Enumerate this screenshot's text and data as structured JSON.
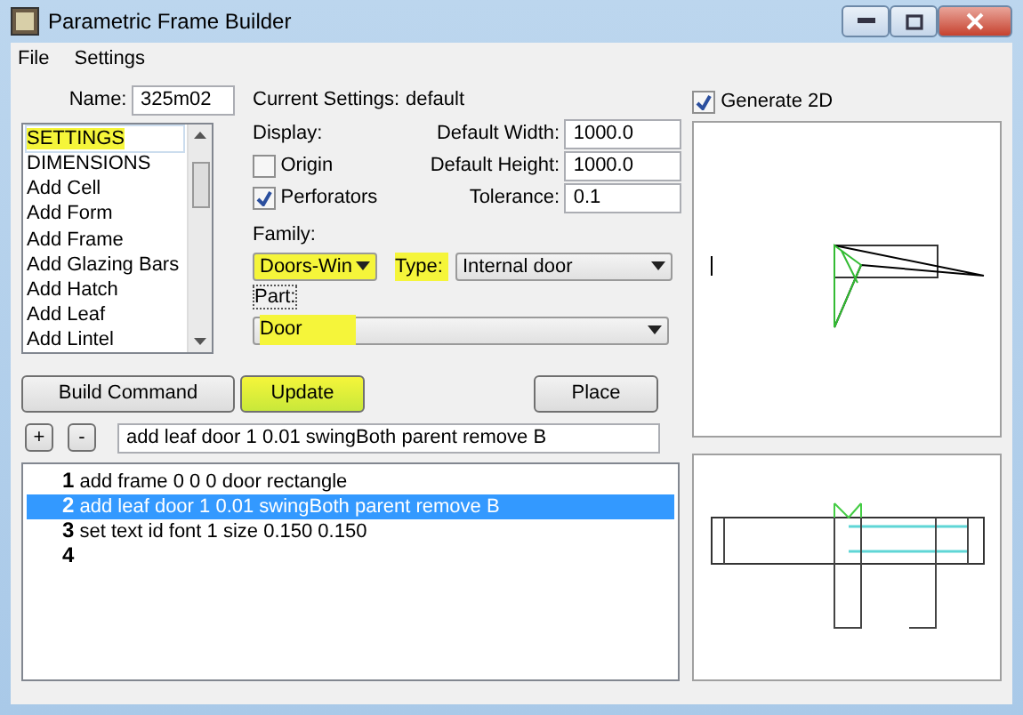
{
  "window": {
    "title": "Parametric Frame Builder"
  },
  "menu": [
    "File",
    "Settings"
  ],
  "name": {
    "label": "Name:",
    "value": "325m02"
  },
  "current_settings": {
    "label": "Current Settings:",
    "value": "default"
  },
  "commands": [
    {
      "label": "SETTINGS",
      "selected": true,
      "highlighted": true
    },
    {
      "label": "DIMENSIONS",
      "selected": false,
      "highlighted": false
    },
    {
      "label": "Add Cell",
      "selected": false,
      "highlighted": false
    },
    {
      "label": "Add Form",
      "selected": false,
      "highlighted": false
    },
    {
      "label": "Add Frame",
      "selected": false,
      "highlighted": false
    },
    {
      "label": "Add Glazing Bars",
      "selected": false,
      "highlighted": false
    },
    {
      "label": "Add Hatch",
      "selected": false,
      "highlighted": false
    },
    {
      "label": "Add Leaf",
      "selected": false,
      "highlighted": false
    },
    {
      "label": "Add Lintel",
      "selected": false,
      "highlighted": false
    }
  ],
  "display": {
    "label": "Display:",
    "options": [
      {
        "label": "Origin",
        "checked": false
      },
      {
        "label": "Perforators",
        "checked": true
      }
    ]
  },
  "defaults": [
    {
      "label": "Default Width:",
      "value": "1000.0"
    },
    {
      "label": "Default Height:",
      "value": "1000.0"
    },
    {
      "label": "Tolerance:",
      "value": "0.1"
    }
  ],
  "family": {
    "label": "Family:",
    "value": "Doors-Win",
    "highlighted": true
  },
  "type": {
    "label": "Type:",
    "value": "Internal door",
    "highlighted": true
  },
  "part": {
    "label": "Part:",
    "value": "Door",
    "highlighted": true
  },
  "buttons": [
    {
      "label": "Build Command",
      "highlighted": false
    },
    {
      "label": "Update",
      "highlighted": true
    },
    {
      "label": "Place",
      "highlighted": false
    }
  ],
  "step_buttons": [
    "+",
    "-"
  ],
  "command_line": {
    "value": "add leaf door 1 0.01 swingBoth parent remove B"
  },
  "output": [
    {
      "number": "1",
      "text": "add frame 0 0 0 door rectangle",
      "selected": false
    },
    {
      "number": "2",
      "text": "add leaf door 1 0.01 swingBoth parent remove B",
      "selected": true
    },
    {
      "number": "3",
      "text": "set text id font 1 size 0.150 0.150",
      "selected": false
    },
    {
      "number": "4",
      "selected": false
    }
  ],
  "generate_2d": {
    "label": "Generate 2D",
    "checked": true
  }
}
